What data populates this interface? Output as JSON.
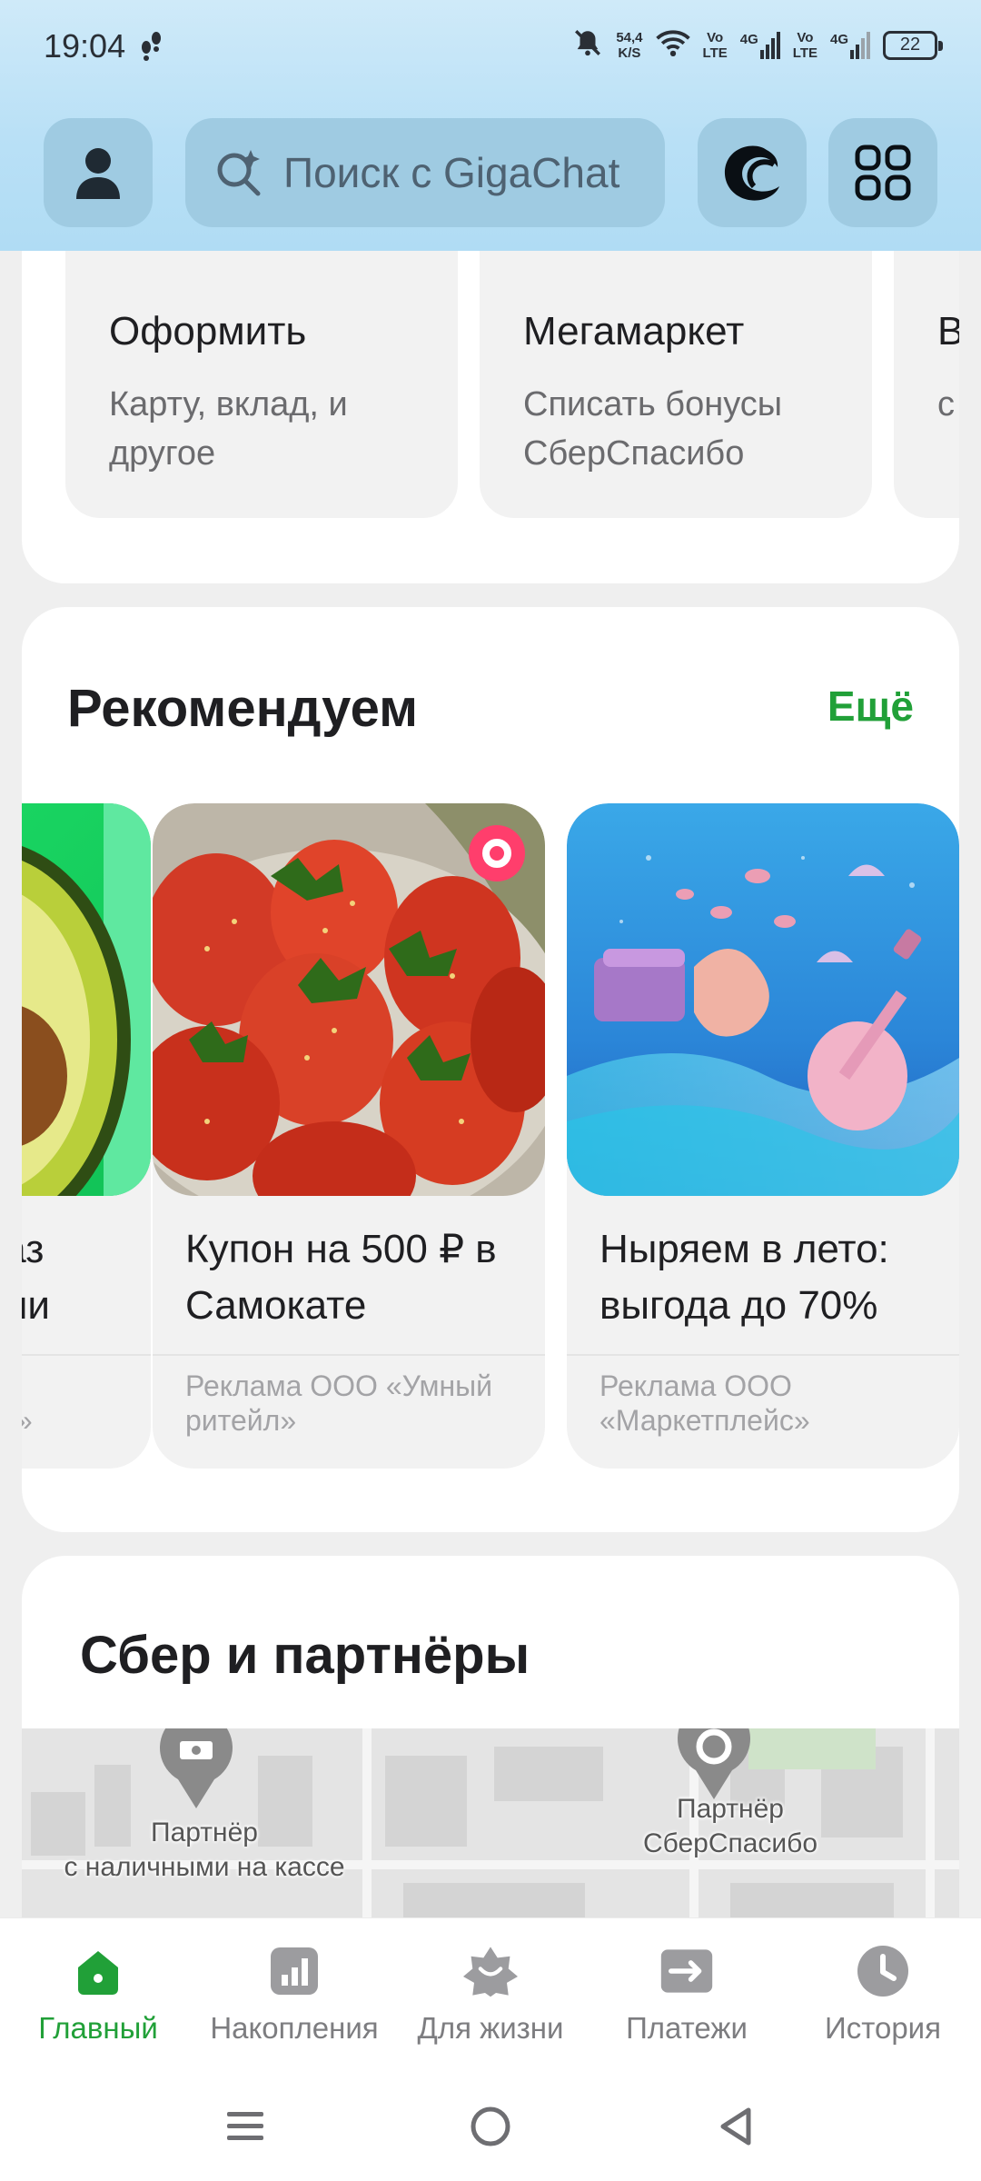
{
  "status_bar": {
    "time": "19:04",
    "net_speed_value": "54,4",
    "net_speed_unit": "K/S",
    "volte1_top": "Vo",
    "volte1_bottom": "LTE",
    "sig1_label": "4G",
    "volte2_top": "Vo",
    "volte2_bottom": "LTE",
    "sig2_label": "4G",
    "battery": "22"
  },
  "header": {
    "search_placeholder": "Поиск с GigaChat"
  },
  "actions": [
    {
      "title": "Оформить",
      "subtitle": "Карту, вклад, и другое"
    },
    {
      "title": "Мегамаркет",
      "subtitle": "Списать бонусы СберСпасибо"
    },
    {
      "title": "В",
      "subtitle": "с"
    }
  ],
  "recommend": {
    "title": "Рекомендуем",
    "more": "Ещё",
    "cards": [
      {
        "title": "каз\nачи",
        "ad": "ис»"
      },
      {
        "title": "Купон на 500 ₽ в Самокате",
        "ad": "Реклама ООО «Умный ритейл»"
      },
      {
        "title": "Ныряем в лето: выгода до 70%",
        "ad": "Реклама ООО «Маркетплейс»"
      }
    ]
  },
  "partners": {
    "title": "Сбер и партнёры",
    "map_labels": [
      "Партнёр\nс наличными на кассе",
      "Партнёр\nСберСпасибо"
    ]
  },
  "bottom_nav": [
    {
      "label": "Главный",
      "active": true
    },
    {
      "label": "Накопления",
      "active": false
    },
    {
      "label": "Для жизни",
      "active": false
    },
    {
      "label": "Платежи",
      "active": false
    },
    {
      "label": "История",
      "active": false
    }
  ],
  "colors": {
    "accent": "#21a038",
    "header_bg": "#b9e0f6",
    "button_bg": "#9fcbe2"
  },
  "icons": {
    "profile": "person-icon",
    "search": "gigachat-search-icon",
    "giga": "gigachat-logo-icon",
    "apps": "apps-grid-icon"
  }
}
